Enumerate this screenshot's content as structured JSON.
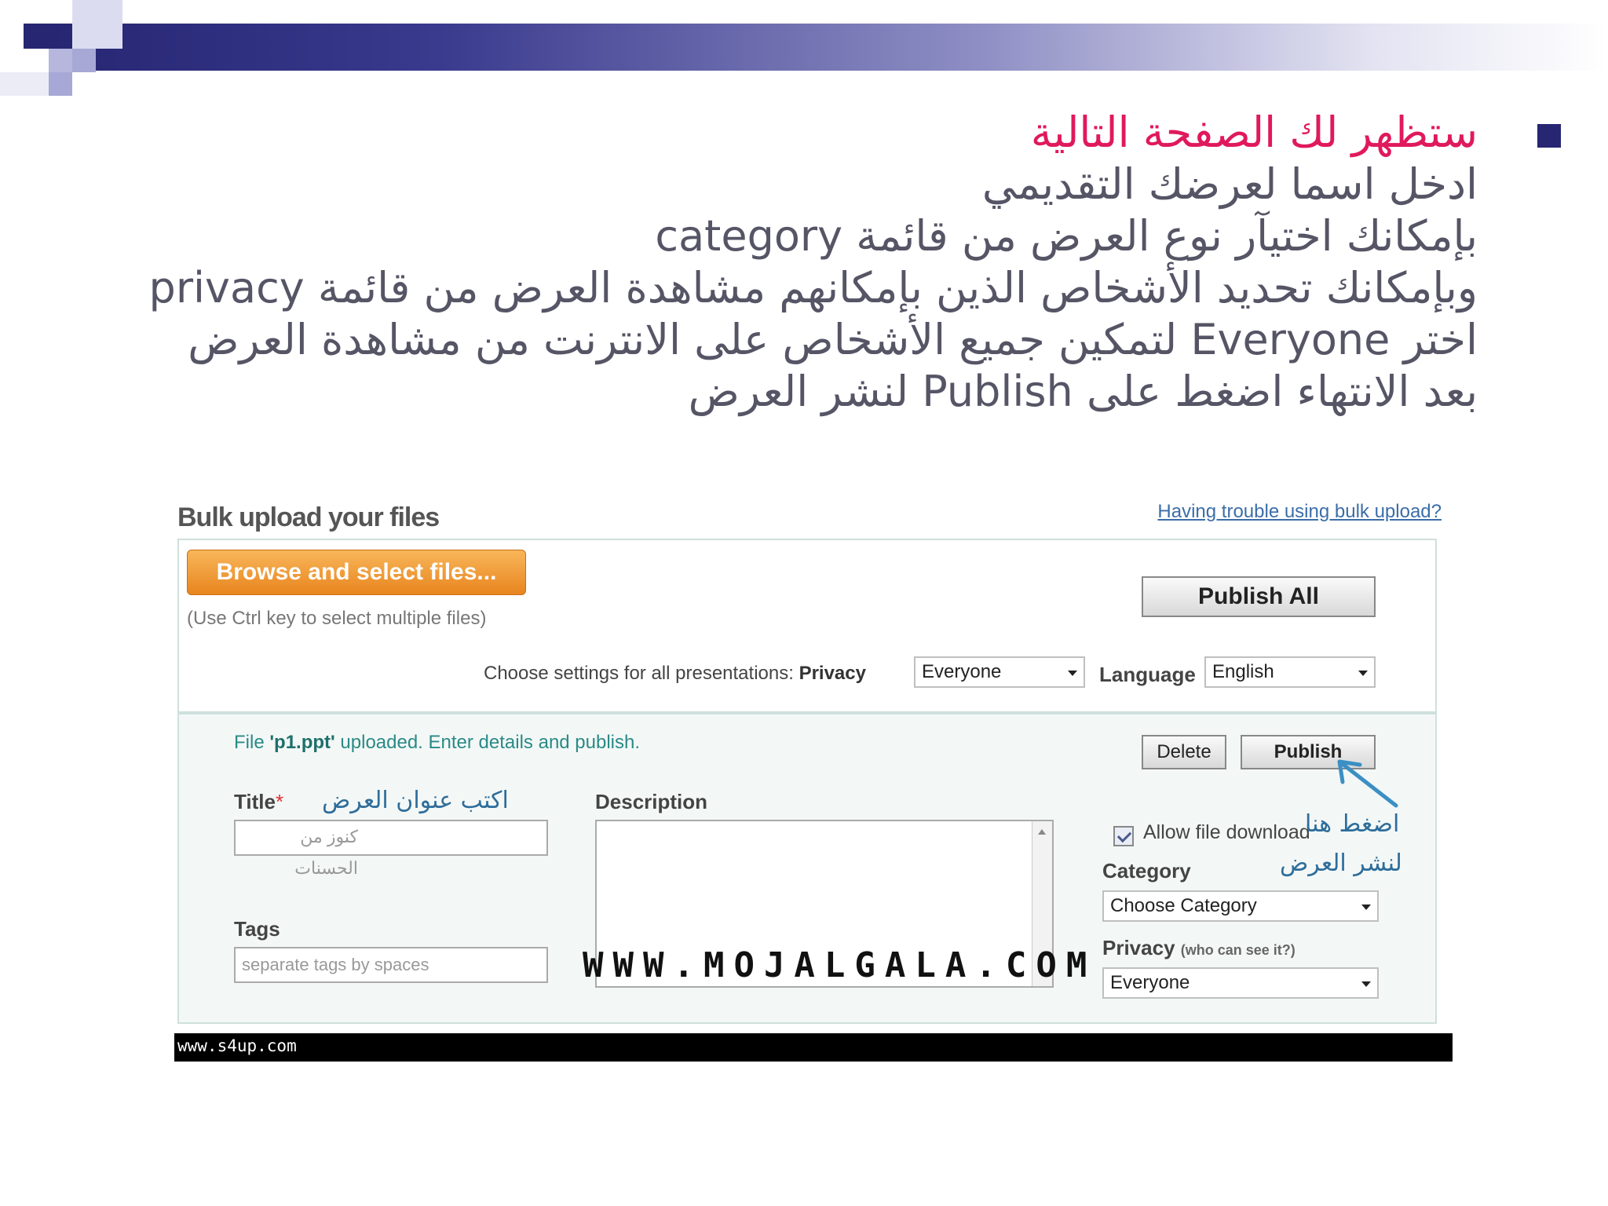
{
  "slide": {
    "lines": [
      "ستظهر لك الصفحة التالية",
      "ادخل اسما لعرضك التقديمي",
      "بإمكانك اختيآر نوع العرض من قائمة category",
      "وبإمكانك تحديد الأشخاص الذين بإمكانهم مشاهدة العرض من قائمة privacy",
      "اختر Everyone لتمكين جميع الأشخاص على الانترنت من مشاهدة العرض",
      "بعد الانتهاء اضغط على Publish لنشر العرض"
    ],
    "accent_color": "#e0195c",
    "theme_color": "#262673"
  },
  "upload": {
    "title": "Bulk upload your files",
    "trouble_link": "Having trouble using bulk upload?",
    "browse_button": "Browse and select files...",
    "hint": "(Use Ctrl key to select multiple files)",
    "publish_all_button": "Publish All",
    "settings_label": "Choose settings for all presentations:",
    "privacy_label": "Privacy",
    "privacy_value": "Everyone",
    "language_label": "Language",
    "language_value": "English",
    "file_msg_prefix": "File ",
    "file_name": "'p1.ppt'",
    "file_msg_suffix": " uploaded. Enter details and publish.",
    "delete_button": "Delete",
    "publish_button": "Publish",
    "title_label": "Title",
    "required_mark": "*",
    "title_value": "كنوز من الحسنات",
    "description_label": "Description",
    "tags_label": "Tags",
    "tags_placeholder": "separate tags by spaces",
    "allow_download": "Allow file download",
    "category_label": "Category",
    "category_value": "Choose Category",
    "privacy2_label": "Privacy",
    "privacy2_hint": "(who can see it?)",
    "privacy2_value": "Everyone",
    "note_title": "اكتب عنوان العرض",
    "note_publish_1": "اضغط هنا",
    "note_publish_2": "لنشر العرض",
    "watermark": "WWW.MOJALGALA.COM",
    "site": "www.s4up.com"
  }
}
